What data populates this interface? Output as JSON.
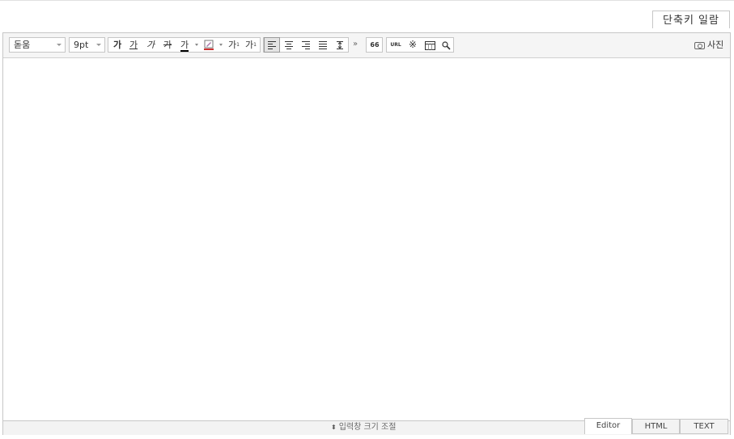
{
  "shortcut_button": "단축키 일람",
  "toolbar": {
    "font_family": "돋움",
    "font_size": "9pt",
    "bold": "가",
    "underline": "가",
    "italic": "가",
    "strikethrough": "가",
    "font_color": "가",
    "superscript": "가",
    "superscript_mark": "1",
    "subscript": "가",
    "subscript_mark": "1",
    "more": "»",
    "quote": "66",
    "link": "URL",
    "special_char": "※",
    "photo_label": "사진"
  },
  "status": {
    "resize_label": "입력창 크기 조절",
    "resize_arrow": "⬍"
  },
  "tabs": [
    {
      "label": "Editor"
    },
    {
      "label": "HTML"
    },
    {
      "label": "TEXT"
    }
  ]
}
